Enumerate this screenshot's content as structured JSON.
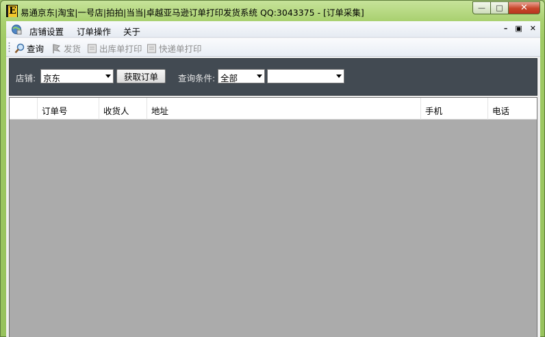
{
  "window": {
    "title": "易通京东|淘宝|一号店|拍拍|当当|卓越亚马逊订单打印发货系统 QQ:3043375 - [订单采集]",
    "icon_letter": "E",
    "minimize": "—",
    "maximize": "□",
    "close": "✕"
  },
  "menu": {
    "items": [
      "店铺设置",
      "订单操作",
      "关于"
    ],
    "mdi": {
      "minimize": "–",
      "restore": "▣",
      "close": "✕"
    }
  },
  "toolbar": {
    "items": [
      {
        "label": "查询",
        "icon": "magnifier-icon",
        "enabled": true
      },
      {
        "label": "发货",
        "icon": "flag-icon",
        "enabled": false
      },
      {
        "label": "出库单打印",
        "icon": "print-icon",
        "enabled": false
      },
      {
        "label": "快递单打印",
        "icon": "print-icon",
        "enabled": false
      }
    ]
  },
  "filter": {
    "shop_label": "店铺:",
    "shop_value": "京东",
    "fetch_button": "获取订单",
    "query_label": "查询条件:",
    "query_value": "全部",
    "query_extra_value": ""
  },
  "grid": {
    "columns": [
      "",
      "订单号",
      "收货人",
      "地址",
      "手机",
      "电话"
    ],
    "rows": []
  },
  "colors": {
    "frame": "#a9d06f",
    "filter_panel": "#424a52",
    "grid_empty": "#ababab"
  }
}
